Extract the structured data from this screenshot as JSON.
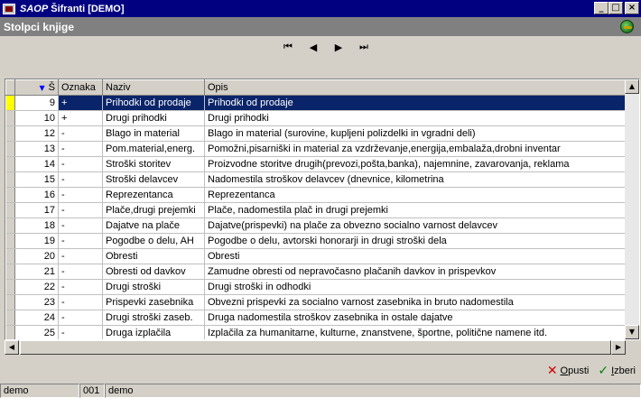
{
  "window": {
    "brand": "SAOP",
    "title": "Šifranti [DEMO]",
    "buttons": [
      "_",
      "□",
      "×"
    ]
  },
  "form": {
    "title": "Stolpci knjige",
    "icon": "globe-icon"
  },
  "navigator": {
    "first": "⏮",
    "prev": "◀",
    "next": "▶",
    "last": "⏭"
  },
  "grid": {
    "columns": [
      "Š",
      "Oznaka",
      "Naziv",
      "Opis"
    ],
    "rows": [
      {
        "num": "9",
        "oznaka": "+",
        "naziv": "Prihodki od prodaje",
        "opis": "Prihodki od prodaje",
        "selected": true
      },
      {
        "num": "10",
        "oznaka": "+",
        "naziv": "Drugi prihodki",
        "opis": "Drugi prihodki"
      },
      {
        "num": "12",
        "oznaka": "-",
        "naziv": "Blago in material",
        "opis": "Blago in material (surovine, kupljeni polizdelki in vgradni deli)"
      },
      {
        "num": "13",
        "oznaka": "-",
        "naziv": "Pom.material,energ.",
        "opis": "Pomožni,pisarniški in material za vzdrževanje,energija,embalaža,drobni inventar"
      },
      {
        "num": "14",
        "oznaka": "-",
        "naziv": "Stroški storitev",
        "opis": "Proizvodne storitve drugih(prevozi,pošta,banka), najemnine, zavarovanja, reklama"
      },
      {
        "num": "15",
        "oznaka": "-",
        "naziv": "Stroški delavcev",
        "opis": "Nadomestila stroškov delavcev (dnevnice, kilometrina"
      },
      {
        "num": "16",
        "oznaka": "-",
        "naziv": "Reprezentanca",
        "opis": "Reprezentanca"
      },
      {
        "num": "17",
        "oznaka": "-",
        "naziv": "Plače,drugi prejemki",
        "opis": "Plače, nadomestila plač in drugi prejemki"
      },
      {
        "num": "18",
        "oznaka": "-",
        "naziv": "Dajatve na plače",
        "opis": "Dajatve(prispevki) na plače za obvezno socialno varnost delavcev"
      },
      {
        "num": "19",
        "oznaka": "-",
        "naziv": "Pogodbe o delu, AH",
        "opis": "Pogodbe o delu, avtorski honorarji in drugi stroški dela"
      },
      {
        "num": "20",
        "oznaka": "-",
        "naziv": "Obresti",
        "opis": "Obresti"
      },
      {
        "num": "21",
        "oznaka": "-",
        "naziv": "Obresti od davkov",
        "opis": "Zamudne obresti od nepravočasno plačanih davkov in prispevkov"
      },
      {
        "num": "22",
        "oznaka": "-",
        "naziv": "Drugi stroški",
        "opis": "Drugi stroški in odhodki"
      },
      {
        "num": "23",
        "oznaka": "-",
        "naziv": "Prispevki zasebnika",
        "opis": "Obvezni prispevki za socialno varnost zasebnika in bruto nadomestila"
      },
      {
        "num": "24",
        "oznaka": "-",
        "naziv": "Drugi stroški zaseb.",
        "opis": "Druga nadomestila stroškov zasebnika in ostale dajatve"
      },
      {
        "num": "25",
        "oznaka": "-",
        "naziv": "Druga izplačila",
        "opis": "Izplačila za humanitarne, kulturne, znanstvene, športne, politične namene itd."
      }
    ]
  },
  "actions": {
    "cancel": {
      "hotkey": "O",
      "rest": "pusti"
    },
    "select": {
      "hotkey": "I",
      "rest": "zberi"
    }
  },
  "statusbar": {
    "user": "demo",
    "company_code": "001",
    "company": "demo"
  }
}
